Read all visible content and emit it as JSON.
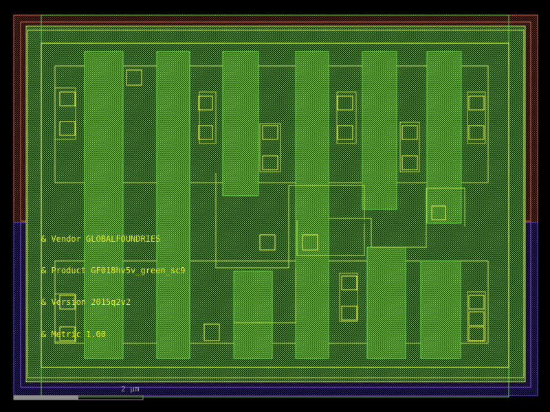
{
  "texts": {
    "vendor": "& Vendor GLOBALFOUNDRIES",
    "product": "& Product GF018hv5v_green_sc9",
    "version": "& Version 2015q2v2",
    "metric": "& Metric 1.00",
    "scale_label": "2 µm"
  },
  "colors": {
    "background": "#000000",
    "nwell": "#d4604a",
    "pwell": "#6a3fe0",
    "boundary": "#c8dc52",
    "diffusion": "#5fd83a",
    "poly": "#b8e03c",
    "metal": "#d8ee40",
    "contact": "#e8ee40",
    "text": "#e6f000",
    "scale_bar": "#909090",
    "scale_text": "#a0a0a0"
  },
  "icons": {
    "contact_square": "contact-via-icon"
  }
}
